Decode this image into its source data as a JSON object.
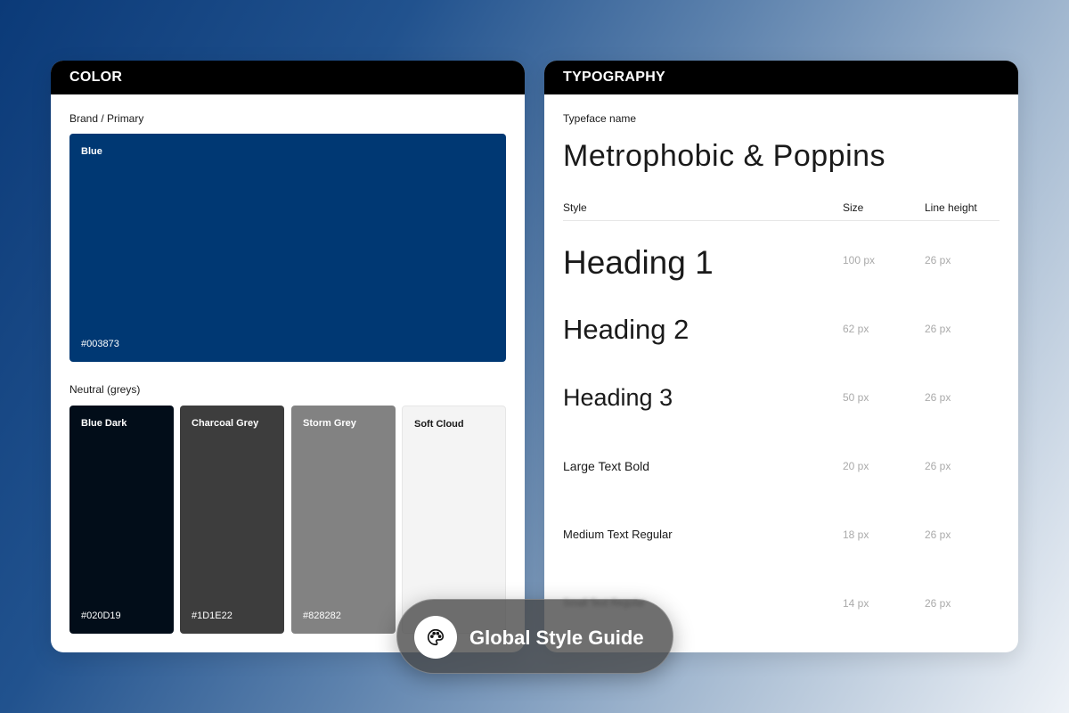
{
  "color_card": {
    "title": "COLOR",
    "primary_label": "Brand / Primary",
    "primary": {
      "name": "Blue",
      "hex": "#003873",
      "color": "#003873"
    },
    "neutral_label": "Neutral (greys)",
    "greys": [
      {
        "name": "Blue Dark",
        "hex": "#020D19",
        "color": "#020D19",
        "text_color": "#ffffff"
      },
      {
        "name": "Charcoal Grey",
        "hex": "#1D1E22",
        "color": "#3D3D3D",
        "text_color": "#ffffff"
      },
      {
        "name": "Storm Grey",
        "hex": "#828282",
        "color": "#828282",
        "text_color": "#ffffff"
      },
      {
        "name": "Soft Cloud",
        "hex": "",
        "color": "#F4F4F4",
        "text_color": "#1a1a1a"
      }
    ]
  },
  "typography_card": {
    "title": "TYPOGRAPHY",
    "typeface_label": "Typeface name",
    "typeface_name": "Metrophobic & Poppins",
    "columns": {
      "style": "Style",
      "size": "Size",
      "line_height": "Line height"
    },
    "rows": [
      {
        "style": "Heading 1",
        "size": "100 px",
        "line_height": "26 px"
      },
      {
        "style": "Heading 2",
        "size": "62 px",
        "line_height": "26 px"
      },
      {
        "style": "Heading 3",
        "size": "50 px",
        "line_height": "26 px"
      },
      {
        "style": "Large Text Bold",
        "size": "20 px",
        "line_height": "26 px"
      },
      {
        "style": "Medium Text Regular",
        "size": "18 px",
        "line_height": "26 px"
      },
      {
        "style": "Small Text Regular",
        "size": "14 px",
        "line_height": "26 px"
      }
    ]
  },
  "badge": {
    "icon": "palette-icon",
    "label": "Global Style Guide"
  }
}
